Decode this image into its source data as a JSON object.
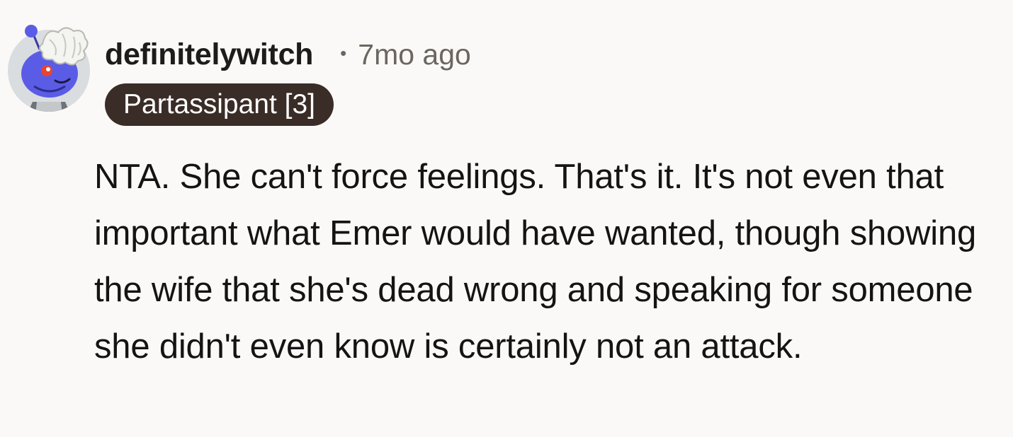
{
  "comment": {
    "author": "definitelywitch",
    "separator": "•",
    "timestamp": "7mo ago",
    "flair": "Partassipant [3]",
    "avatar_icon": "snoo-avatar-icon",
    "body": "NTA. She can't force feelings. That's it. It's not even that important what Emer would have wanted, though showing the wife that she's dead wrong and speaking for someone she didn't even know is certainly not an attack."
  },
  "colors": {
    "background": "#fbf9f7",
    "flair_bg": "#3a2c27",
    "flair_text": "#ffffff",
    "meta_text": "#6b6661",
    "avatar_body": "#5b5ce6",
    "avatar_bg": "#d9dde0"
  }
}
